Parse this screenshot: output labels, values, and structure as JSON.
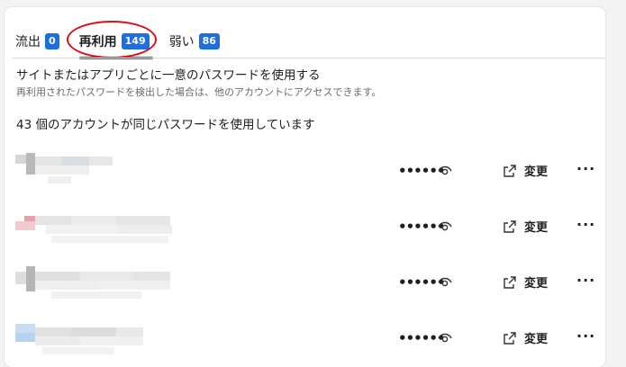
{
  "tabs": [
    {
      "label": "流出",
      "count": "0"
    },
    {
      "label": "再利用",
      "count": "149"
    },
    {
      "label": "弱い",
      "count": "86"
    }
  ],
  "description": {
    "title": "サイトまたはアプリごとに一意のパスワードを使用する",
    "subtitle": "再利用されたパスワードを検出した場合は、他のアカウントにアクセスできます。"
  },
  "summary": "43 個のアカウントが同じパスワードを使用しています",
  "rows": [
    {
      "masked_password": "••••••",
      "change_label": "変更"
    },
    {
      "masked_password": "••••••",
      "change_label": "変更"
    },
    {
      "masked_password": "••••••",
      "change_label": "変更"
    },
    {
      "masked_password": "••••••",
      "change_label": "変更"
    }
  ],
  "colors": {
    "accent": "#1d6de3",
    "highlight_circle": "#d8121c"
  },
  "icons": {
    "eye": "eye-icon",
    "open_external": "open-external-icon",
    "more": "more-options-icon"
  }
}
